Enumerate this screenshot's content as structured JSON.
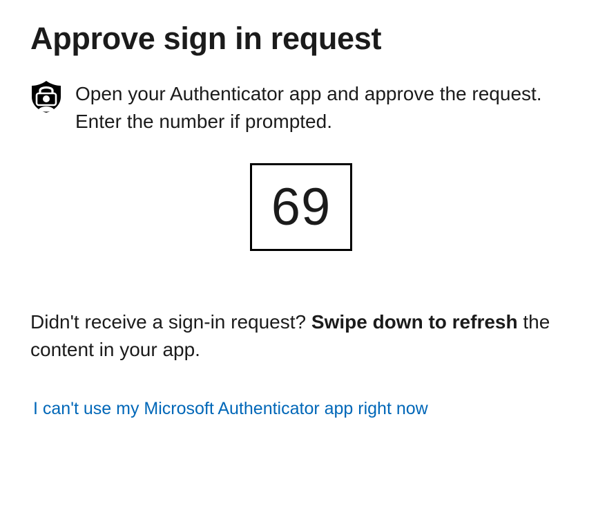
{
  "header": {
    "title": "Approve sign in request"
  },
  "instruction": {
    "icon": "authenticator-lock-icon",
    "text": "Open your Authenticator app and approve the request. Enter the number if prompted."
  },
  "number_match": {
    "value": "69"
  },
  "refresh_hint": {
    "prefix": "Didn't receive a sign-in request? ",
    "bold": "Swipe down to refresh",
    "suffix": " the content in your app."
  },
  "alternate_link": {
    "label": "I can't use my Microsoft Authenticator app right now",
    "color": "#0067b8"
  }
}
